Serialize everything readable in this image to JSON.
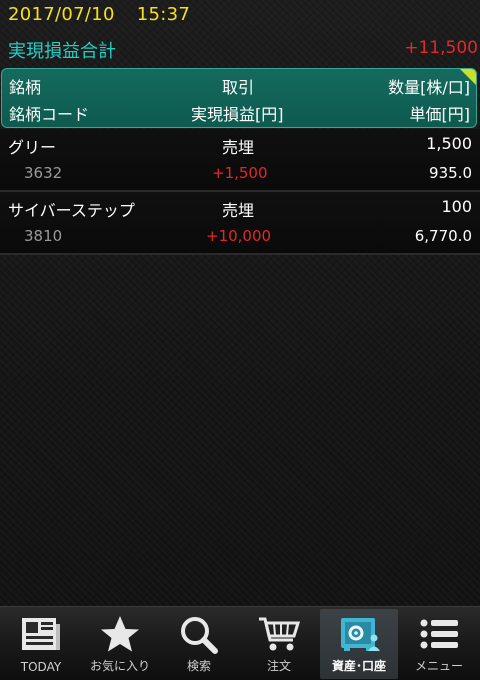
{
  "status": {
    "date": "2017/07/10",
    "time": "15:37"
  },
  "summary": {
    "label": "実現損益合計",
    "value": "+11,500"
  },
  "header": {
    "row1": {
      "col1": "銘柄",
      "col2": "取引",
      "col3": "数量[株/口]"
    },
    "row2": {
      "col1": "銘柄コード",
      "col2": "実現損益[円]",
      "col3": "単価[円]"
    }
  },
  "rows": [
    {
      "name": "グリー",
      "trade": "売埋",
      "qty": "1,500",
      "code": "3632",
      "pnl": "+1,500",
      "price": "935.0"
    },
    {
      "name": "サイバーステップ",
      "trade": "売埋",
      "qty": "100",
      "code": "3810",
      "pnl": "+10,000",
      "price": "6,770.0"
    }
  ],
  "tabs": [
    {
      "label": "TODAY",
      "icon": "newspaper-icon"
    },
    {
      "label": "お気に入り",
      "icon": "star-icon"
    },
    {
      "label": "検索",
      "icon": "search-icon"
    },
    {
      "label": "注文",
      "icon": "cart-icon"
    },
    {
      "label": "資産･口座",
      "icon": "safe-icon",
      "active": true
    },
    {
      "label": "メニュー",
      "icon": "menu-icon"
    }
  ],
  "colors": {
    "accent": "#1fd0c6",
    "date": "#f5e11a",
    "profit": "#e6262a",
    "header_bg": "#0d5a4f"
  }
}
